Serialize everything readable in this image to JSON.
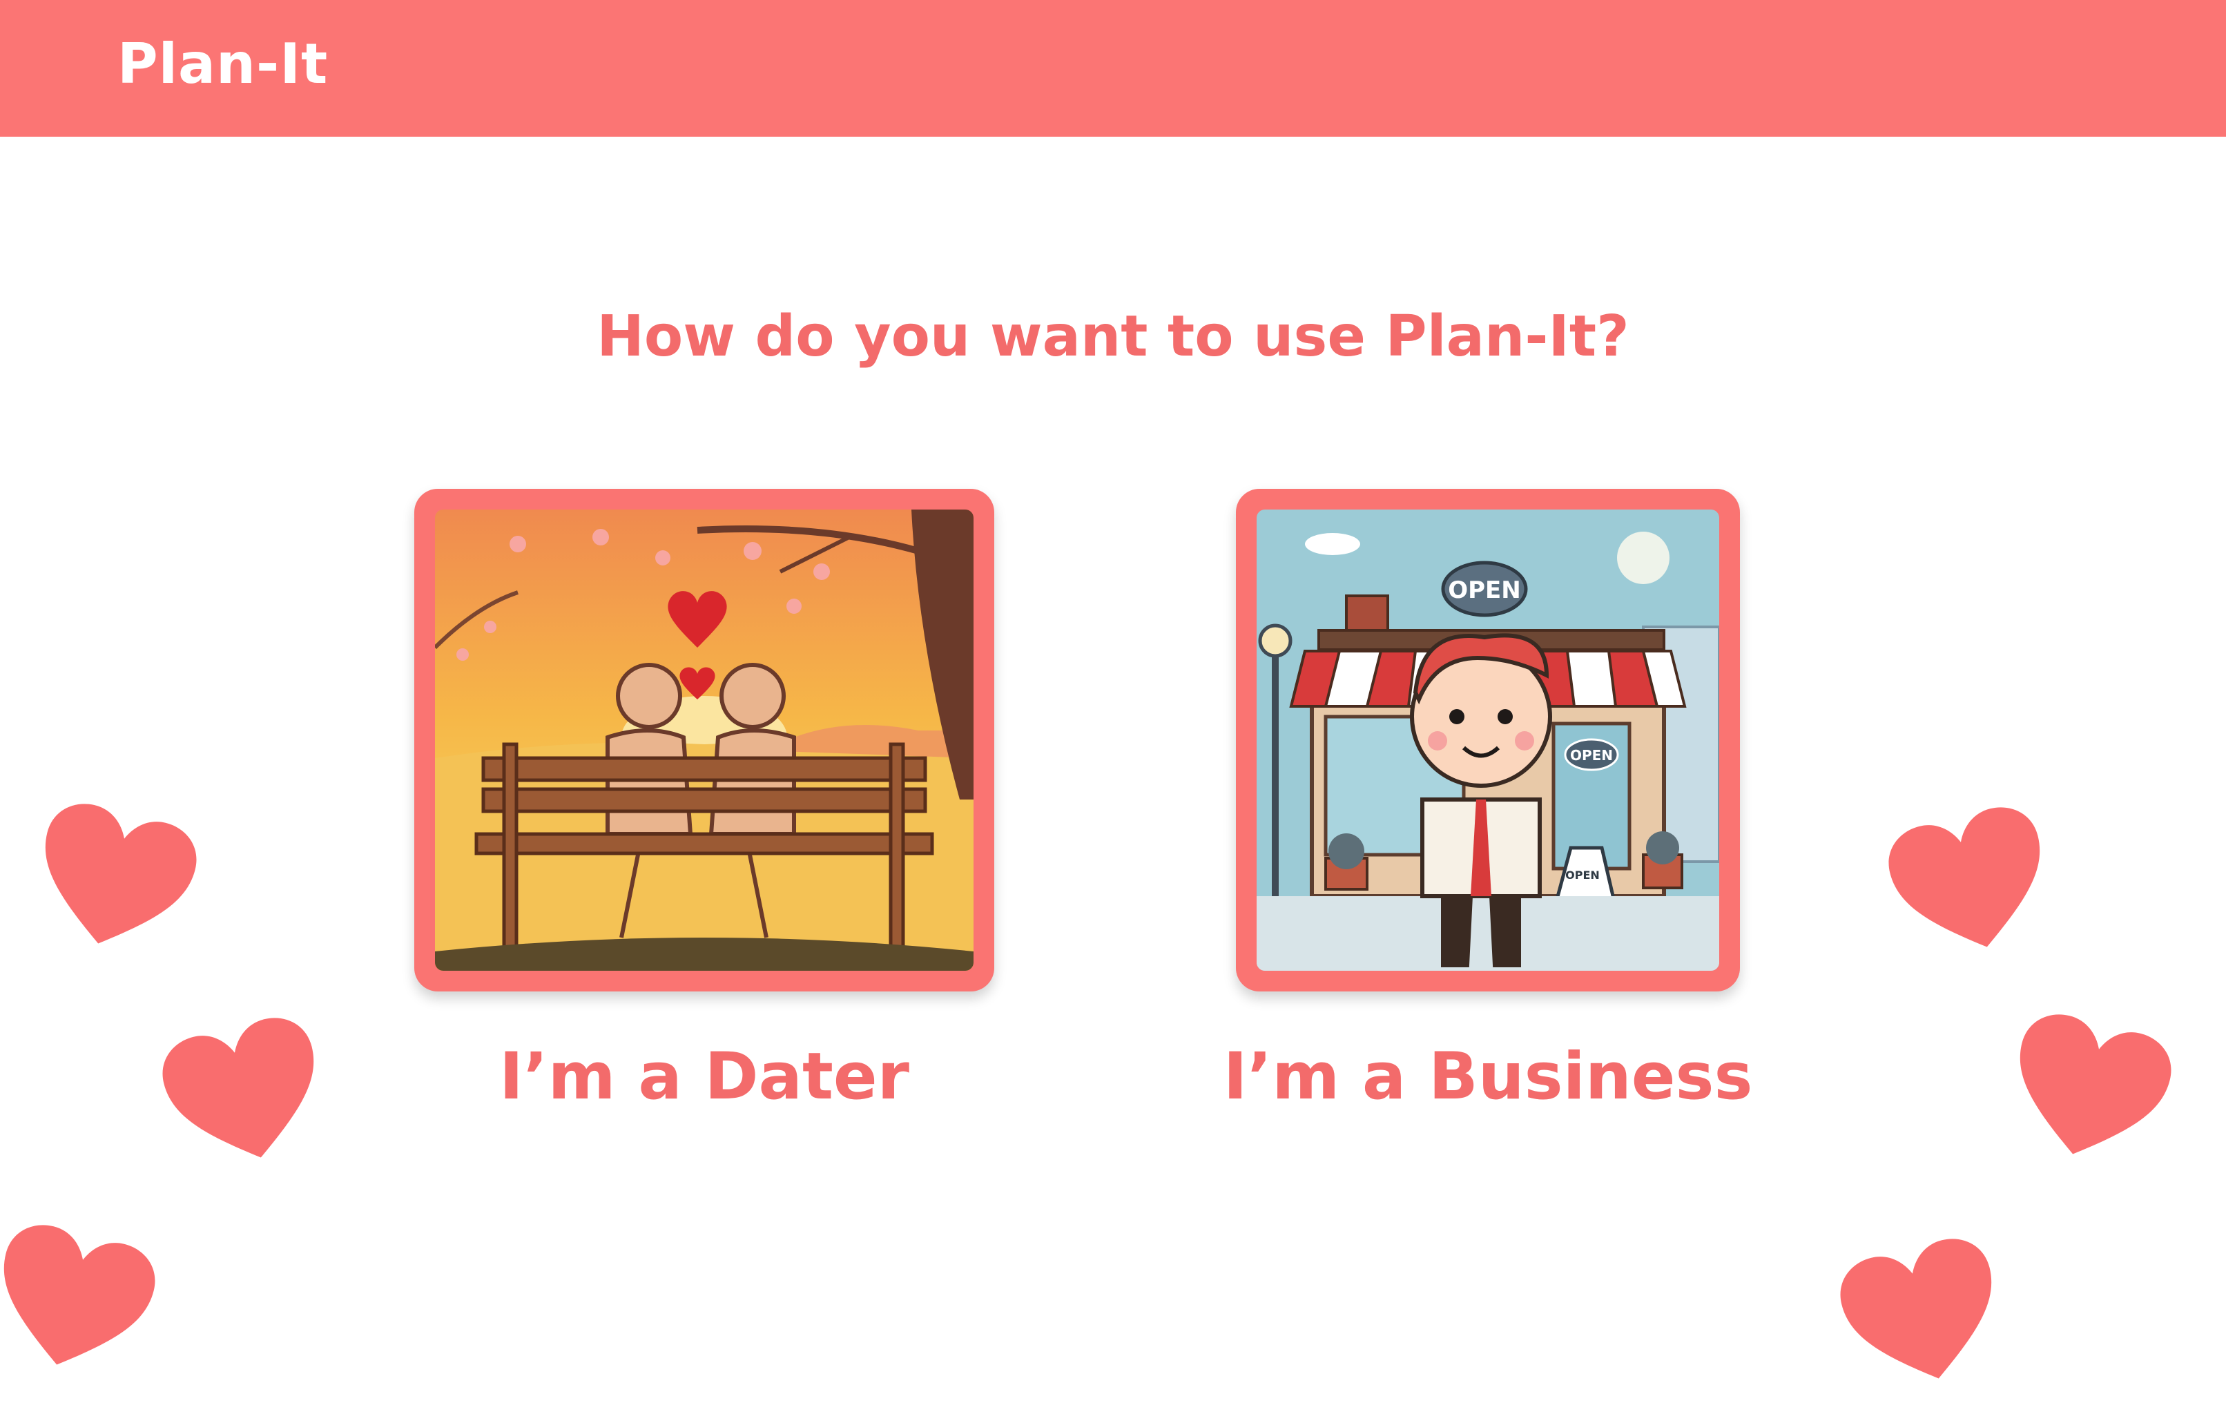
{
  "header": {
    "brand": "Plan-It"
  },
  "main": {
    "question": "How do you want to use Plan-It?",
    "options": [
      {
        "label": "I’m a Dater",
        "image": "couple-on-bench-illustration"
      },
      {
        "label": "I’m a Business",
        "image": "shop-owner-storefront-illustration"
      }
    ],
    "illustration_text": {
      "sign_large": "OPEN",
      "sign_door": "OPEN",
      "sign_board": "OPEN"
    }
  },
  "colors": {
    "accent": "#fb7574",
    "heart": "#f96d6e",
    "text": "#f36b6b",
    "background": "#ffffff"
  },
  "decorations": {
    "icon": "heart-icon",
    "count": 6
  }
}
